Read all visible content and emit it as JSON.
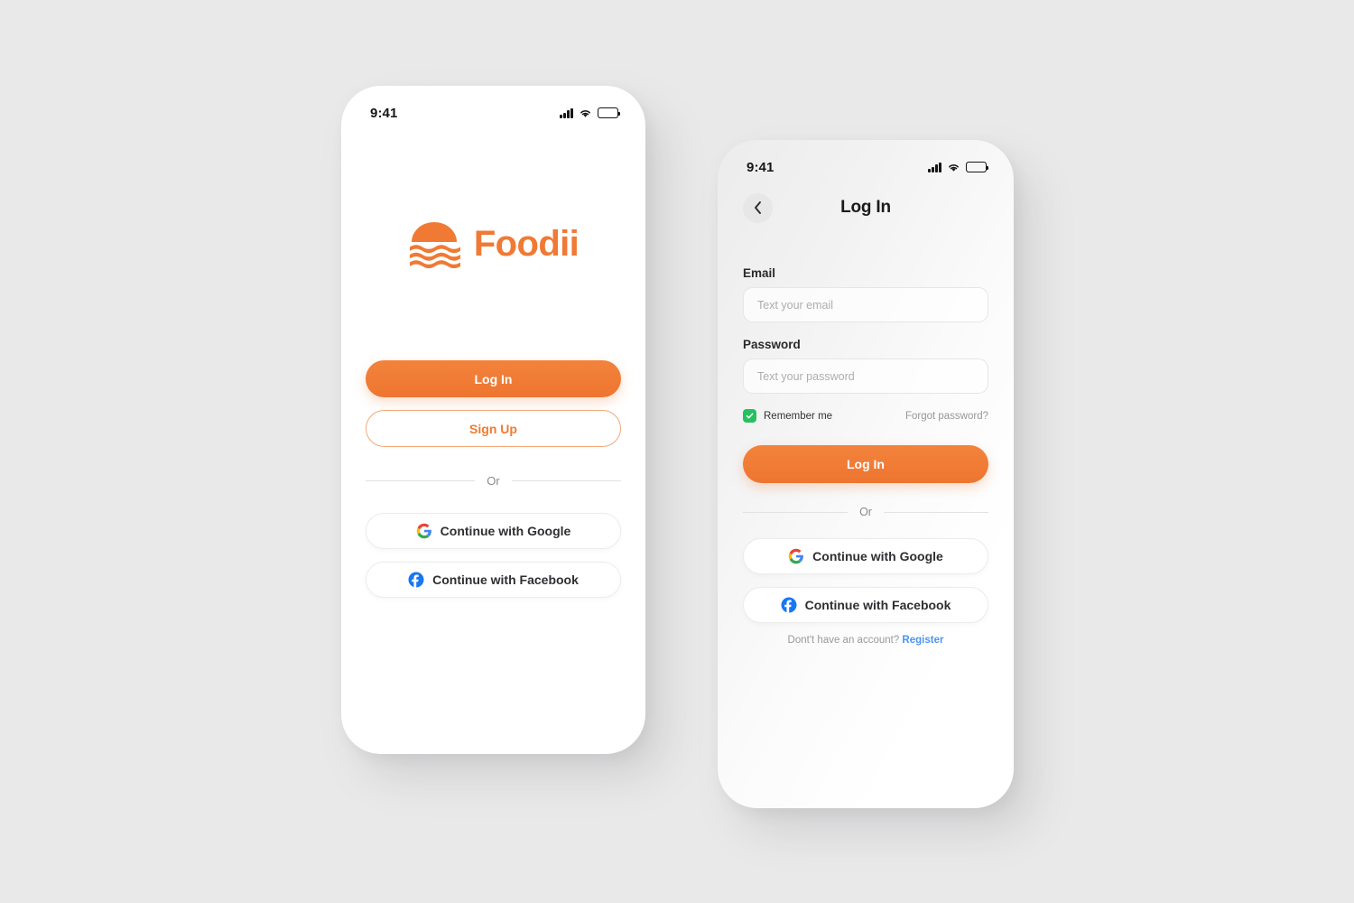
{
  "canvas": {
    "background_color": "#e9e9e9",
    "accent_color": "#f07a34",
    "checkbox_color": "#25c15f",
    "link_color": "#4d95f0"
  },
  "welcome_screen": {
    "status_bar": {
      "time": "9:41",
      "signal_icon": "cellular-signal-icon",
      "wifi_icon": "wifi-icon",
      "battery_icon": "battery-full-icon"
    },
    "logo": {
      "mark_icon": "foodii-sunrise-wave-logo-icon",
      "wordmark": "Foodii"
    },
    "primary_button": "Log In",
    "secondary_button": "Sign Up",
    "divider_label": "Or",
    "social_buttons": [
      {
        "label": "Continue with Google",
        "icon": "google-icon"
      },
      {
        "label": "Continue with Facebook",
        "icon": "facebook-icon"
      }
    ]
  },
  "login_screen": {
    "status_bar": {
      "time": "9:41",
      "signal_icon": "cellular-signal-icon",
      "wifi_icon": "wifi-icon",
      "battery_icon": "battery-full-icon"
    },
    "nav": {
      "back_icon": "chevron-left-icon",
      "title": "Log In"
    },
    "fields": [
      {
        "label": "Email",
        "placeholder": "Text your email",
        "value": ""
      },
      {
        "label": "Password",
        "placeholder": "Text your password",
        "value": ""
      }
    ],
    "remember": {
      "label": "Remember me",
      "checked": true,
      "check_icon": "checkmark-icon"
    },
    "forgot_link": "Forgot password?",
    "primary_button": "Log In",
    "divider_label": "Or",
    "social_buttons": [
      {
        "label": "Continue with Google",
        "icon": "google-icon"
      },
      {
        "label": "Continue with Facebook",
        "icon": "facebook-icon"
      }
    ],
    "register_prompt": "Dont't have an account?",
    "register_link": "Register"
  }
}
